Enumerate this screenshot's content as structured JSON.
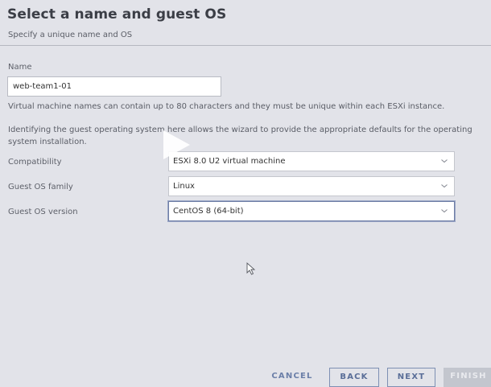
{
  "header": {
    "title": "Select a name and guest OS",
    "subtitle": "Specify a unique name and OS"
  },
  "name_field": {
    "label": "Name",
    "value": "web-team1-01",
    "help": "Virtual machine names can contain up to 80 characters and they must be unique within each ESXi instance."
  },
  "guest_os": {
    "help": "Identifying the guest operating system here allows the wizard to provide the appropriate defaults for the operating system installation.",
    "compatibility_label": "Compatibility",
    "compatibility_value": "ESXi 8.0 U2 virtual machine",
    "family_label": "Guest OS family",
    "family_value": "Linux",
    "version_label": "Guest OS version",
    "version_value": "CentOS 8 (64-bit)"
  },
  "footer": {
    "cancel": "CANCEL",
    "back": "BACK",
    "next": "NEXT",
    "finish": "FINISH"
  },
  "colors": {
    "background": "#e2e3e9",
    "accent": "#5a6e98",
    "disabled_button": "#c3c6ce"
  },
  "icons": [
    "chevron-down-icon",
    "play-overlay-icon",
    "mouse-cursor-icon"
  ]
}
